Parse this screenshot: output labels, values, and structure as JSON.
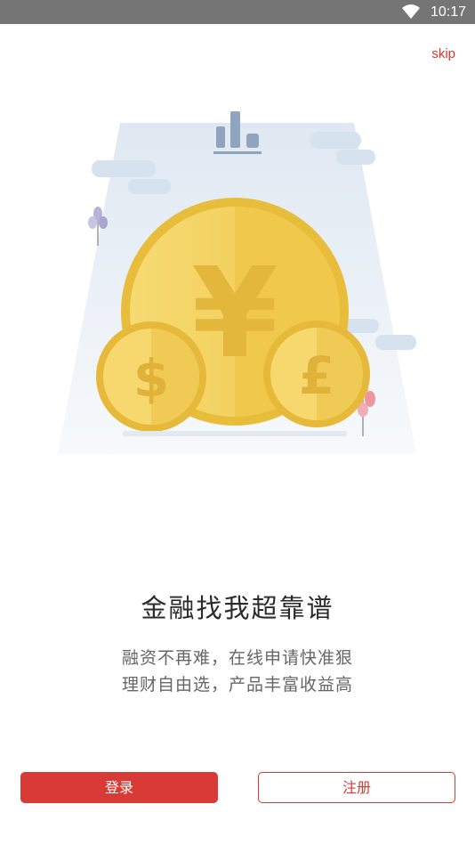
{
  "status_bar": {
    "time": "10:17",
    "wifi_icon": "wifi-icon"
  },
  "skip_label": "skip",
  "illustration": {
    "icon": "coins-illustration",
    "currency_symbols": [
      "¥",
      "$",
      "£"
    ]
  },
  "headline": "金融找我超靠谱",
  "subtext_lines": [
    "融资不再难，在线申请快准狠",
    "理财自由选，产品丰富收益高"
  ],
  "buttons": {
    "login_label": "登录",
    "register_label": "注册"
  },
  "colors": {
    "accent": "#d83a36",
    "coin_gold": "#f2cf5a",
    "status_bar": "#757575"
  }
}
